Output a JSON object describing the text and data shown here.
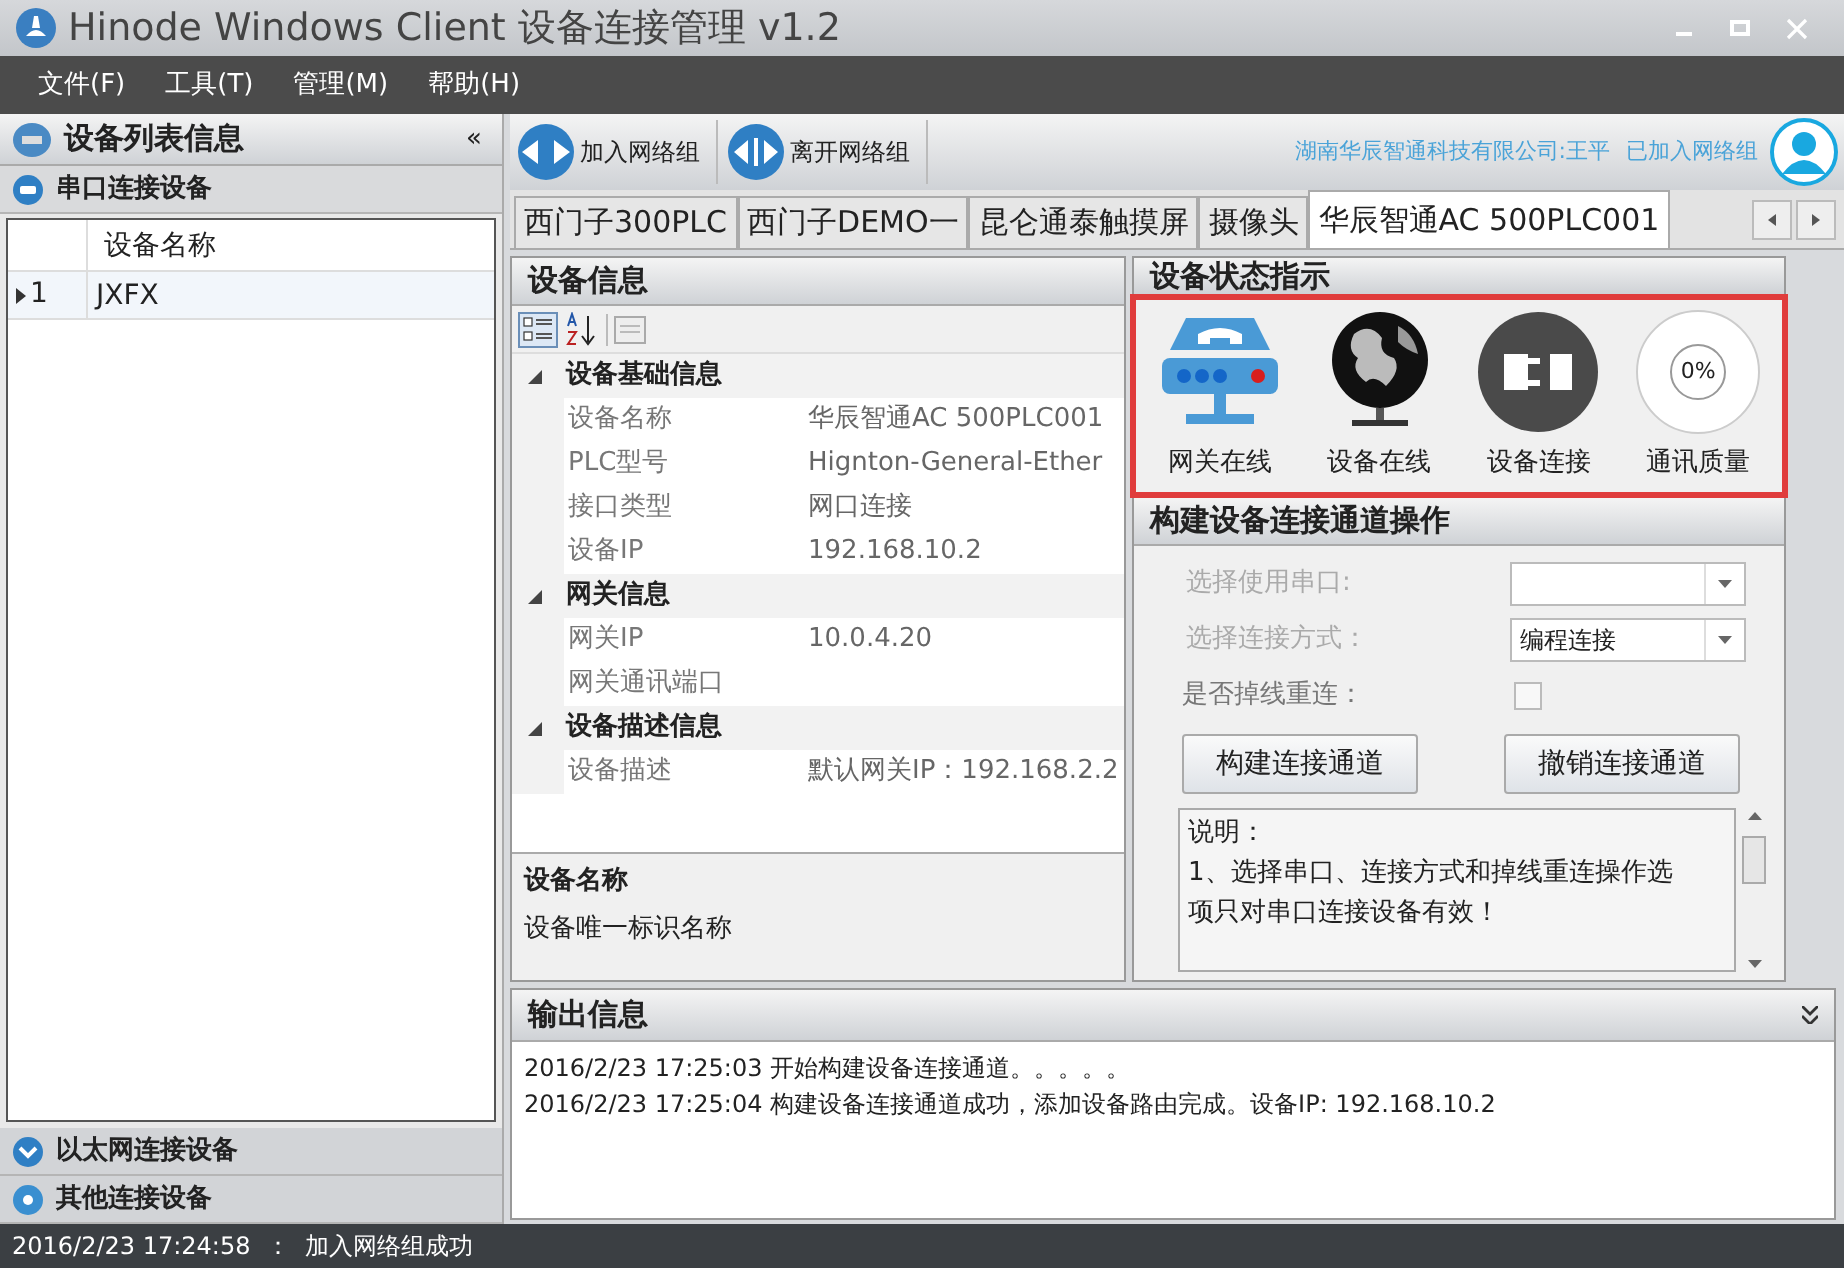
{
  "window": {
    "title": "Hinode Windows Client 设备连接管理 v1.2"
  },
  "menu": [
    {
      "label": "文件(F)"
    },
    {
      "label": "工具(T)"
    },
    {
      "label": "管理(M)"
    },
    {
      "label": "帮助(H)"
    }
  ],
  "sidebar": {
    "title": "设备列表信息",
    "collapse": "«",
    "sections": [
      {
        "label": "串口连接设备",
        "expanded": true,
        "kind": "serial",
        "columns": [
          "设备名称"
        ],
        "rows": [
          {
            "index": "1",
            "name": "JXFX",
            "selected": true
          }
        ]
      },
      {
        "label": "以太网连接设备",
        "expanded": false,
        "kind": "ethernet"
      },
      {
        "label": "其他连接设备",
        "expanded": false,
        "kind": "other"
      }
    ]
  },
  "toolbar": {
    "buttons": [
      {
        "label": "加入网络组",
        "kind": "join"
      },
      {
        "label": "离开网络组",
        "kind": "leave"
      }
    ],
    "user": "湖南华辰智通科技有限公司:王平",
    "status": "已加入网络组"
  },
  "tabs": [
    {
      "label": "西门子300PLC",
      "selected": false
    },
    {
      "label": "西门子DEMO一",
      "selected": false
    },
    {
      "label": "昆仑通泰触摸屏",
      "selected": false
    },
    {
      "label": "摄像头",
      "selected": false
    },
    {
      "label": "华辰智通AC 500PLC001",
      "selected": true
    }
  ],
  "device_info": {
    "title": "设备信息",
    "categories": [
      {
        "name": "设备基础信息",
        "expanded": true,
        "properties": [
          {
            "name": "设备名称",
            "value": "华辰智通AC 500PLC001"
          },
          {
            "name": "PLC型号",
            "value": "Hignton-General-Ether"
          },
          {
            "name": "接口类型",
            "value": "网口连接"
          },
          {
            "name": "设备IP",
            "value": "192.168.10.2"
          }
        ]
      },
      {
        "name": "网关信息",
        "expanded": true,
        "properties": [
          {
            "name": "网关IP",
            "value": "10.0.4.20"
          },
          {
            "name": "网关通讯端口"
          }
        ]
      },
      {
        "name": "设备描述信息",
        "expanded": true,
        "properties": [
          {
            "name": "设备描述",
            "value": "默认网关IP：192.168.2.2"
          }
        ]
      }
    ],
    "help": {
      "title": "设备名称",
      "text": "设备唯一标识名称"
    }
  },
  "status": {
    "title": "设备状态指示",
    "indicators": [
      {
        "kind": "gateway",
        "label": "网关在线"
      },
      {
        "kind": "globe",
        "label": "设备在线"
      },
      {
        "kind": "plug",
        "label": "设备连接"
      },
      {
        "kind": "quality",
        "label": "通讯质量",
        "reading": "0%"
      }
    ]
  },
  "channel": {
    "title": "构建设备连接通道操作",
    "fields": [
      {
        "kind": "select",
        "label": "选择使用串口:",
        "disabled": true
      },
      {
        "kind": "select",
        "label": "选择连接方式：",
        "disabled": true,
        "value": "编程连接"
      },
      {
        "kind": "checkbox",
        "label": "是否掉线重连：",
        "disabled": false,
        "checked": false
      }
    ],
    "buttons": [
      "构建连接通道",
      "撤销连接通道"
    ],
    "note": {
      "title": "说明：",
      "text": "1、选择串口、连接方式和掉线重连操作选项只对串口连接设备有效！"
    }
  },
  "output": {
    "title": "输出信息",
    "lines": [
      "2016/2/23 17:25:03 开始构建设备连接通道。。。。。",
      "2016/2/23 17:25:04 构建设备连接通道成功，添加设备路由完成。设备IP: 192.168.10.2"
    ]
  },
  "status_bar": {
    "text": "2016/2/23 17:24:58  ：  加入网络组成功"
  }
}
